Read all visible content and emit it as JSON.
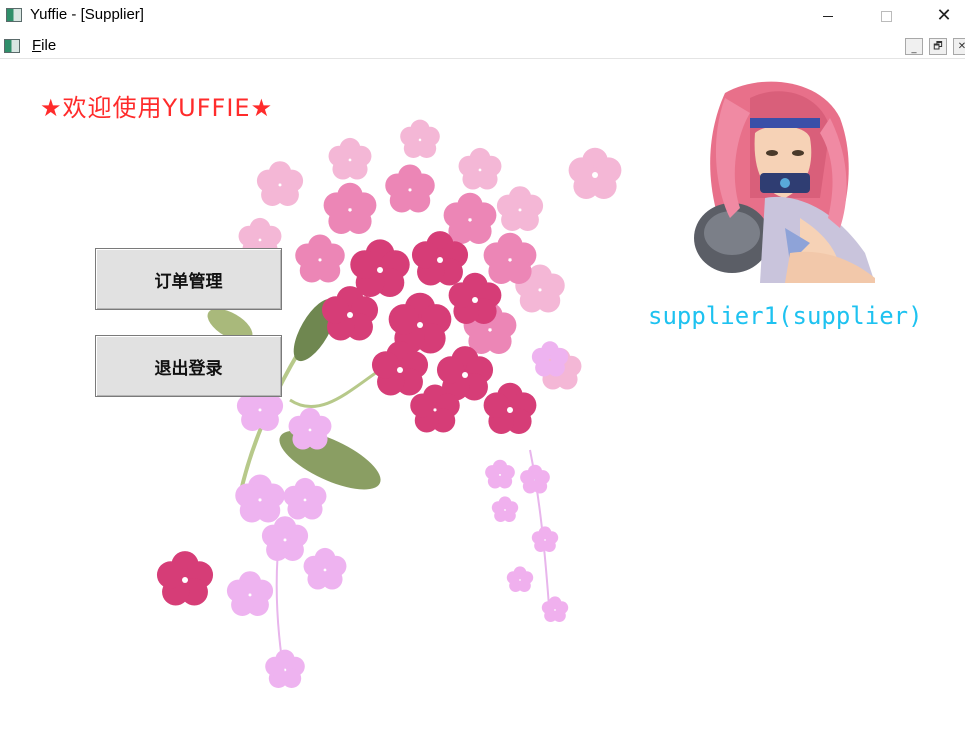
{
  "window": {
    "title": "Yuffie - [Supplier]",
    "controls": {
      "minimize": "—",
      "maximize": "☐",
      "close": "✕"
    }
  },
  "menubar": {
    "file_first": "F",
    "file_rest": "ile",
    "mdi": {
      "minimize": "_",
      "restore": "🗗",
      "close": "✕"
    }
  },
  "content": {
    "welcome": "★欢迎使用YUFFIE★",
    "buttons": {
      "orders": "订单管理",
      "logout": "退出登录"
    },
    "user_label": "supplier1(supplier)"
  },
  "colors": {
    "welcome": "#ff2b2b",
    "user_label": "#1ec2f0",
    "button_bg": "#e1e1e1"
  },
  "icons": {
    "app": "app-window-icon",
    "decoration": "flower-bouquet",
    "avatar": "anime-character-avatar"
  }
}
